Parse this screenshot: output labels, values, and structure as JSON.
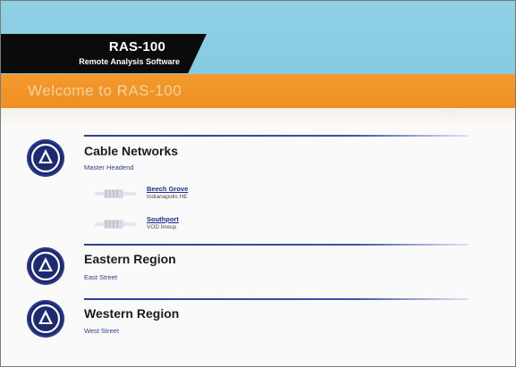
{
  "app": {
    "title": "RAS-100",
    "subtitle": "Remote Analysis Software",
    "welcome": "Welcome to RAS-100"
  },
  "regions": [
    {
      "title": "Cable Networks",
      "subtitle": "Master Headend",
      "icon": "triangle-icon",
      "sites": [
        {
          "name": "Beech Grove",
          "description": "Indianapolis HE",
          "icon": "amplifier-icon"
        },
        {
          "name": "Southport",
          "description": "VOD lineup",
          "icon": "amplifier-icon"
        }
      ]
    },
    {
      "title": "Eastern Region",
      "subtitle": "East Street",
      "icon": "triangle-icon",
      "sites": []
    },
    {
      "title": "Western Region",
      "subtitle": "West Street",
      "icon": "triangle-icon",
      "sites": []
    }
  ],
  "colors": {
    "sky": "#8fd0e4",
    "logo_bg": "#0b0b0b",
    "orange": "#f39a2e",
    "navy": "#1d2a72",
    "link": "#1f2f9a"
  }
}
